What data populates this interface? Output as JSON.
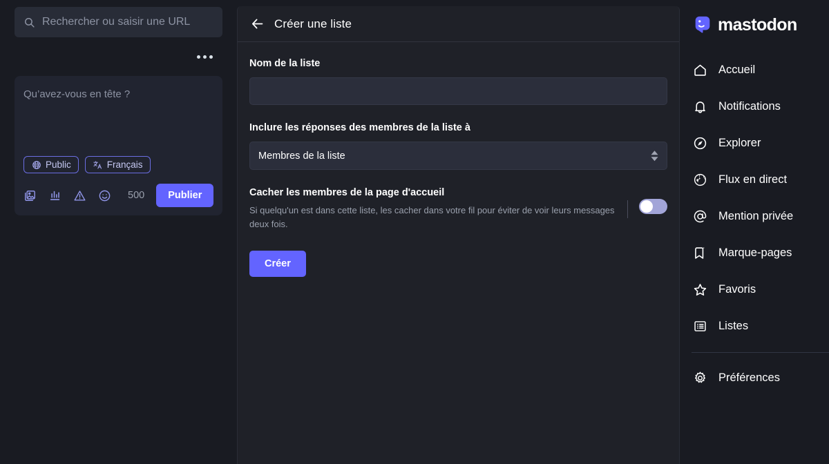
{
  "colors": {
    "app_bg": "#191b22",
    "panel_bg": "#1f2128",
    "compose_bg": "#212430",
    "input_bg": "#2b2e3b",
    "accent": "#6364ff",
    "pill_border": "#6b6ee3",
    "muted_text": "#9aa0ad",
    "switch_track": "#a2a5d8"
  },
  "left": {
    "search": {
      "icon": "search-icon",
      "value": "",
      "placeholder": "Rechercher ou saisir une URL"
    },
    "more_menu": {
      "icon": "ellipsis-icon",
      "label": "..."
    },
    "compose": {
      "placeholder": "Qu’avez-vous en tête ?",
      "value": "",
      "pills": [
        {
          "icon": "globe-icon",
          "label": "Public"
        },
        {
          "icon": "translate-icon",
          "label": "Français"
        }
      ],
      "actions": [
        {
          "icon": "image-stack-icon",
          "label": "Ajouter des images"
        },
        {
          "icon": "poll-icon",
          "label": "Ajouter un sondage"
        },
        {
          "icon": "warning-triangle-icon",
          "label": "Avertissement de contenu"
        },
        {
          "icon": "emoji-smiley-icon",
          "label": "Insérer un émoji"
        }
      ],
      "char_count": "500",
      "publish_label": "Publier"
    }
  },
  "center": {
    "header": {
      "back_icon": "arrow-left-icon",
      "title": "Créer une liste"
    },
    "form": {
      "name_field": {
        "label": "Nom de la liste",
        "value": "",
        "placeholder": ""
      },
      "replies_field": {
        "label": "Inclure les réponses des membres de la liste à",
        "selected": "Membres de la liste",
        "icon": "chevron-updown-icon"
      },
      "hide_members": {
        "title": "Cacher les membres de la page d'accueil",
        "description": "Si quelqu'un est dans cette liste, les cacher dans votre fil pour éviter de voir leurs messages deux fois.",
        "enabled": false
      },
      "submit_label": "Créer"
    }
  },
  "right": {
    "brand": {
      "logo_icon": "mastodon-logo-icon",
      "name": "mastodon"
    },
    "nav": [
      {
        "icon": "home-icon",
        "label": "Accueil"
      },
      {
        "icon": "bell-icon",
        "label": "Notifications"
      },
      {
        "icon": "compass-icon",
        "label": "Explorer"
      },
      {
        "icon": "globe-icon",
        "label": "Flux en direct"
      },
      {
        "icon": "at-icon",
        "label": "Mention privée"
      },
      {
        "icon": "bookmark-icon",
        "label": "Marque-pages"
      },
      {
        "icon": "star-icon",
        "label": "Favoris"
      },
      {
        "icon": "list-icon",
        "label": "Listes"
      }
    ],
    "footer_nav": [
      {
        "icon": "gear-icon",
        "label": "Préférences"
      }
    ]
  }
}
